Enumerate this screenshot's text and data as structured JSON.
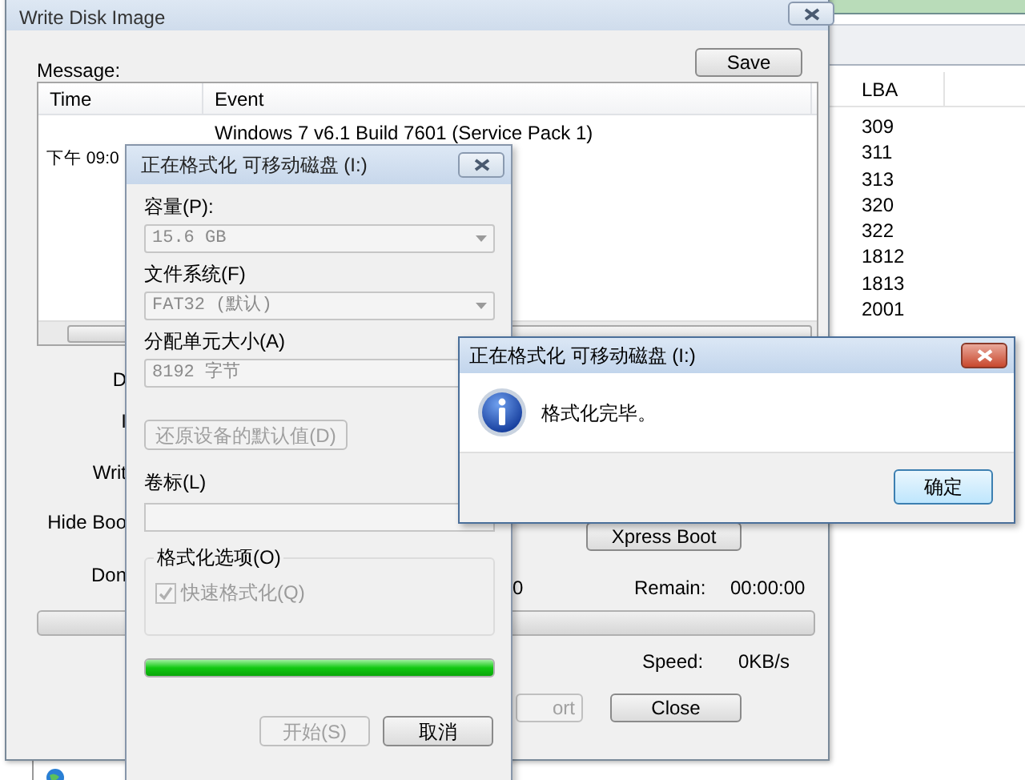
{
  "background_window": {
    "column_header": "LBA",
    "rows": [
      "309",
      "311",
      "313",
      "320",
      "322",
      "1812",
      "1813",
      "2001"
    ]
  },
  "write_disk_image": {
    "title": "Write Disk Image",
    "message_label": "Message:",
    "save_button": "Save",
    "log": {
      "columns": [
        "Time",
        "Event"
      ],
      "rows": [
        {
          "event": "Windows 7 v6.1 Build 7601 (Service Pack 1)"
        },
        {
          "time": "下午 09:0"
        }
      ]
    },
    "cut_labels": [
      "D",
      "I",
      "Writ",
      "Hide Boo",
      "Don"
    ],
    "xpress_boot_button": "Xpress Boot",
    "done_value": "0",
    "remain_label": "Remain:",
    "remain_value": "00:00:00",
    "progress": {
      "level": 0
    },
    "speed_label": "Speed:",
    "speed_value": "0KB/s",
    "buttons": [
      {
        "label": "ort",
        "disabled": true
      },
      {
        "label": "Close",
        "disabled": false
      }
    ]
  },
  "format_dialog": {
    "title": "正在格式化 可移动磁盘 (I:)",
    "fields": [
      {
        "label": "容量(P):",
        "value": "15.6 GB",
        "disabled": true
      },
      {
        "label": "文件系统(F)",
        "value": "FAT32 (默认)",
        "disabled": true
      },
      {
        "label": "分配单元大小(A)",
        "value": "8192 字节",
        "disabled": true
      }
    ],
    "restore_button": {
      "label": "还原设备的默认值(D)",
      "disabled": true
    },
    "volume_label": {
      "label": "卷标(L)",
      "disabled": true
    },
    "options": {
      "legend": "格式化选项(O)",
      "quick_format": {
        "label": "快速格式化(Q)",
        "checked": true,
        "disabled": true
      }
    },
    "progress": {
      "level": 1
    },
    "buttons": [
      {
        "label": "开始(S)",
        "disabled": true
      },
      {
        "label": "取消",
        "disabled": false
      }
    ]
  },
  "message_box": {
    "title": "正在格式化 可移动磁盘 (I:)",
    "message": "格式化完毕。",
    "ok_button": "确定"
  }
}
